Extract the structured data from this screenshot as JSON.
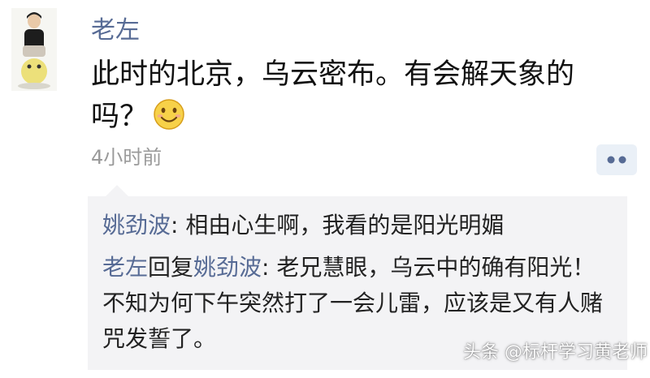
{
  "post": {
    "author": "老左",
    "text": "此时的北京，乌云密布。有会解天象的吗？",
    "emoji": "smile-emoji",
    "time": "4小时前"
  },
  "comments": [
    {
      "author": "姚劲波",
      "separator": ": ",
      "text": "相由心生啊，我看的是阳光明媚"
    },
    {
      "author": "老左",
      "reply_word": "回复",
      "reply_to": "姚劲波",
      "separator": ": ",
      "text": "老兄慧眼，乌云中的确有阳光！不知为何下午突然打了一会儿雷，应该是又有人赌咒发誓了。"
    }
  ],
  "watermark": "头条 @标杆学习黄老师",
  "colors": {
    "name": "#576b95",
    "comment_bg": "#f3f3f5",
    "time": "#9a9a9a"
  }
}
